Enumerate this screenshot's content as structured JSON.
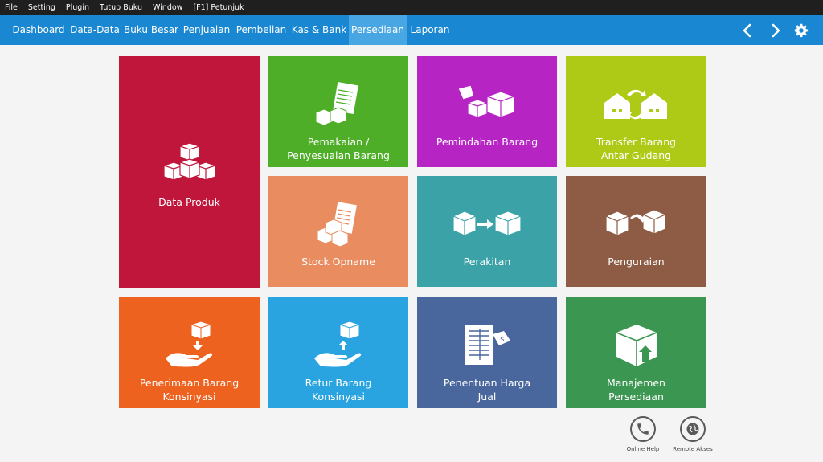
{
  "menu": [
    "File",
    "Setting",
    "Plugin",
    "Tutup Buku",
    "Window",
    "[F1] Petunjuk"
  ],
  "nav": {
    "items": [
      "Dashboard",
      "Data-Data",
      "Buku Besar",
      "Penjualan",
      "Pembelian",
      "Kas & Bank",
      "Persediaan",
      "Laporan"
    ],
    "active_index": 6,
    "icons": [
      "chevron-left-icon",
      "chevron-right-icon",
      "gear-icon"
    ]
  },
  "tiles": {
    "data_produk": {
      "label": [
        "Data Produk"
      ],
      "color": "#c0163b",
      "icon": "boxes-stack-icon"
    },
    "pemakaian": {
      "label": [
        "Pemakaian /",
        "Penyesuaian Barang"
      ],
      "color": "#4eae27",
      "icon": "document-boxes-icon"
    },
    "pemindahan": {
      "label": [
        "Pemindahan Barang"
      ],
      "color": "#b625c4",
      "icon": "box-moving-icon"
    },
    "transfer": {
      "label": [
        "Transfer Barang",
        "Antar Gudang"
      ],
      "color": "#aeca16",
      "icon": "warehouse-transfer-icon"
    },
    "stock_opname": {
      "label": [
        "Stock Opname"
      ],
      "color": "#e98c5f",
      "icon": "stock-document-icon"
    },
    "perakitan": {
      "label": [
        "Perakitan"
      ],
      "color": "#3ba3a8",
      "icon": "box-assembly-icon"
    },
    "penguraian": {
      "label": [
        "Penguraian"
      ],
      "color": "#8e5c44",
      "icon": "box-disassembly-icon"
    },
    "penerimaan": {
      "label": [
        "Penerimaan Barang",
        "Konsinyasi"
      ],
      "color": "#ee6220",
      "icon": "hand-receive-box-icon"
    },
    "retur": {
      "label": [
        "Retur Barang",
        "Konsinyasi"
      ],
      "color": "#2aa4e0",
      "icon": "hand-return-box-icon"
    },
    "penentuan": {
      "label": [
        "Penentuan Harga",
        "Jual"
      ],
      "color": "#49679c",
      "icon": "price-tag-document-icon"
    },
    "manajemen": {
      "label": [
        "Manajemen",
        "Persediaan"
      ],
      "color": "#3b9652",
      "icon": "box-upload-icon"
    }
  },
  "actions": {
    "online_help": {
      "label": "Online Help",
      "icon": "phone-icon"
    },
    "remote_akses": {
      "label": "Remote Akses",
      "icon": "globe-icon"
    }
  }
}
